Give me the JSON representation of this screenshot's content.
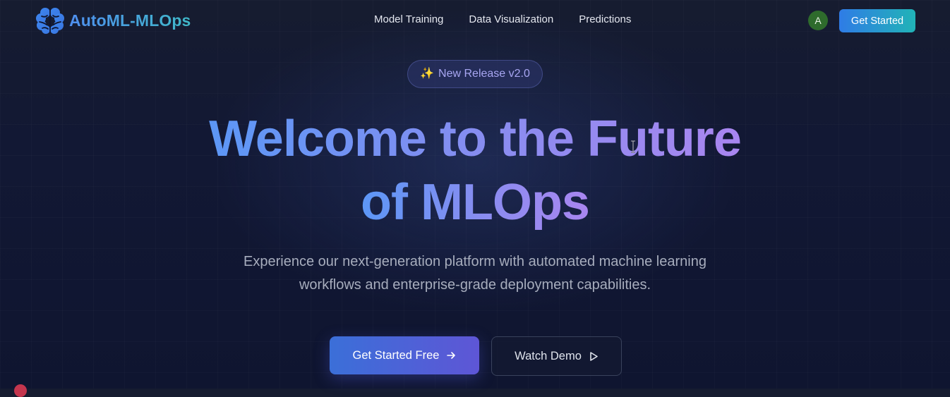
{
  "navbar": {
    "brand": {
      "name": "AutoML-MLOps",
      "icon": "brain-icon"
    },
    "links": [
      "Model Training",
      "Data Visualization",
      "Predictions"
    ],
    "avatar_initial": "A",
    "cta_label": "Get Started"
  },
  "hero": {
    "badge": {
      "icon": "sparkles-icon",
      "text": "New Release v2.0"
    },
    "title_line1": "Welcome to the Future",
    "title_line2": "of MLOps",
    "subtitle": "Experience our next-generation platform with automated machine learning workflows and enterprise-grade deployment capabilities.",
    "primary_cta": {
      "label": "Get Started Free",
      "icon": "arrow-right-icon"
    },
    "secondary_cta": {
      "label": "Watch Demo",
      "icon": "play-icon"
    }
  },
  "colors": {
    "background": "#121834",
    "brand_gradient_start": "#4f8ff0",
    "brand_gradient_end": "#3fb8c8",
    "title_gradient_start": "#5c97f6",
    "title_gradient_end": "#a986f0",
    "cta_gradient_start": "#3b6fd8",
    "cta_gradient_end": "#5e56d6",
    "avatar": "#2e6b2c",
    "badge_text": "#a8a6f2"
  }
}
